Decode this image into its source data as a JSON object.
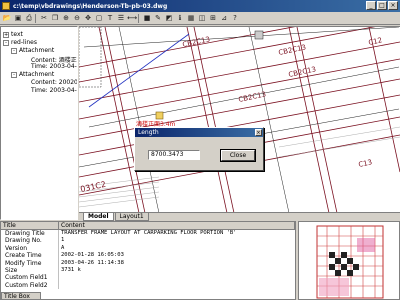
{
  "window": {
    "title": "c:\\temp\\vbdrawings\\Henderson-Tb-pb-03.dwg",
    "minimize": "_",
    "maximize": "□",
    "close": "×"
  },
  "toolbar": {
    "icons": [
      "open-icon",
      "save-icon",
      "print-icon",
      "cut-icon",
      "copy-icon",
      "zoom-in-icon",
      "zoom-out-icon",
      "pan-icon",
      "select-icon",
      "text-icon",
      "layer-icon",
      "measure-icon",
      "save2-icon",
      "paint-icon",
      "color-icon",
      "info-icon",
      "grid-icon",
      "window-icon",
      "tile-icon",
      "ortho-icon",
      "help-icon"
    ]
  },
  "tree": {
    "items": [
      {
        "label": "text",
        "expander": "+"
      },
      {
        "label": "red-lines",
        "expander": "-"
      },
      {
        "label": "Attachment",
        "expander": "-"
      },
      {
        "label": "Content: 酒楼正面"
      },
      {
        "label": "Time: 2003-04-"
      },
      {
        "label": "Attachment",
        "expander": "-"
      },
      {
        "label": "Content: 20020"
      },
      {
        "label": "Time: 2003-04-"
      }
    ]
  },
  "canvas": {
    "labels": [
      "CB2C13",
      "CB2C13",
      "CB2C13",
      "CB2C13",
      "C12",
      "C13",
      "031C2"
    ],
    "annotation": "酒楼正面3.4m"
  },
  "dialog": {
    "title": "Length",
    "close_glyph": "×",
    "value": "8700.3473",
    "button": "Close"
  },
  "tabs": {
    "items": [
      "Model",
      "Layout1"
    ]
  },
  "properties": {
    "headers": [
      "Title",
      "Content"
    ],
    "rows": [
      {
        "name": "Drawing Title",
        "value": "TRANSFER FRAME LAYOUT AT CARPARKING FLOOR PORTION 'B'"
      },
      {
        "name": "Drawing No.",
        "value": "1"
      },
      {
        "name": "Version",
        "value": "A"
      },
      {
        "name": "Create Time",
        "value": "2002-01-28 16:05:03"
      },
      {
        "name": "Modify Time",
        "value": "2003-04-26 11:14:38"
      },
      {
        "name": "Size",
        "value": "3731 k"
      },
      {
        "name": "Custom Field1",
        "value": ""
      },
      {
        "name": "Custom Field2",
        "value": ""
      },
      {
        "name": "Custom Field3",
        "value": ""
      }
    ],
    "footer_tab": "Title Box"
  }
}
